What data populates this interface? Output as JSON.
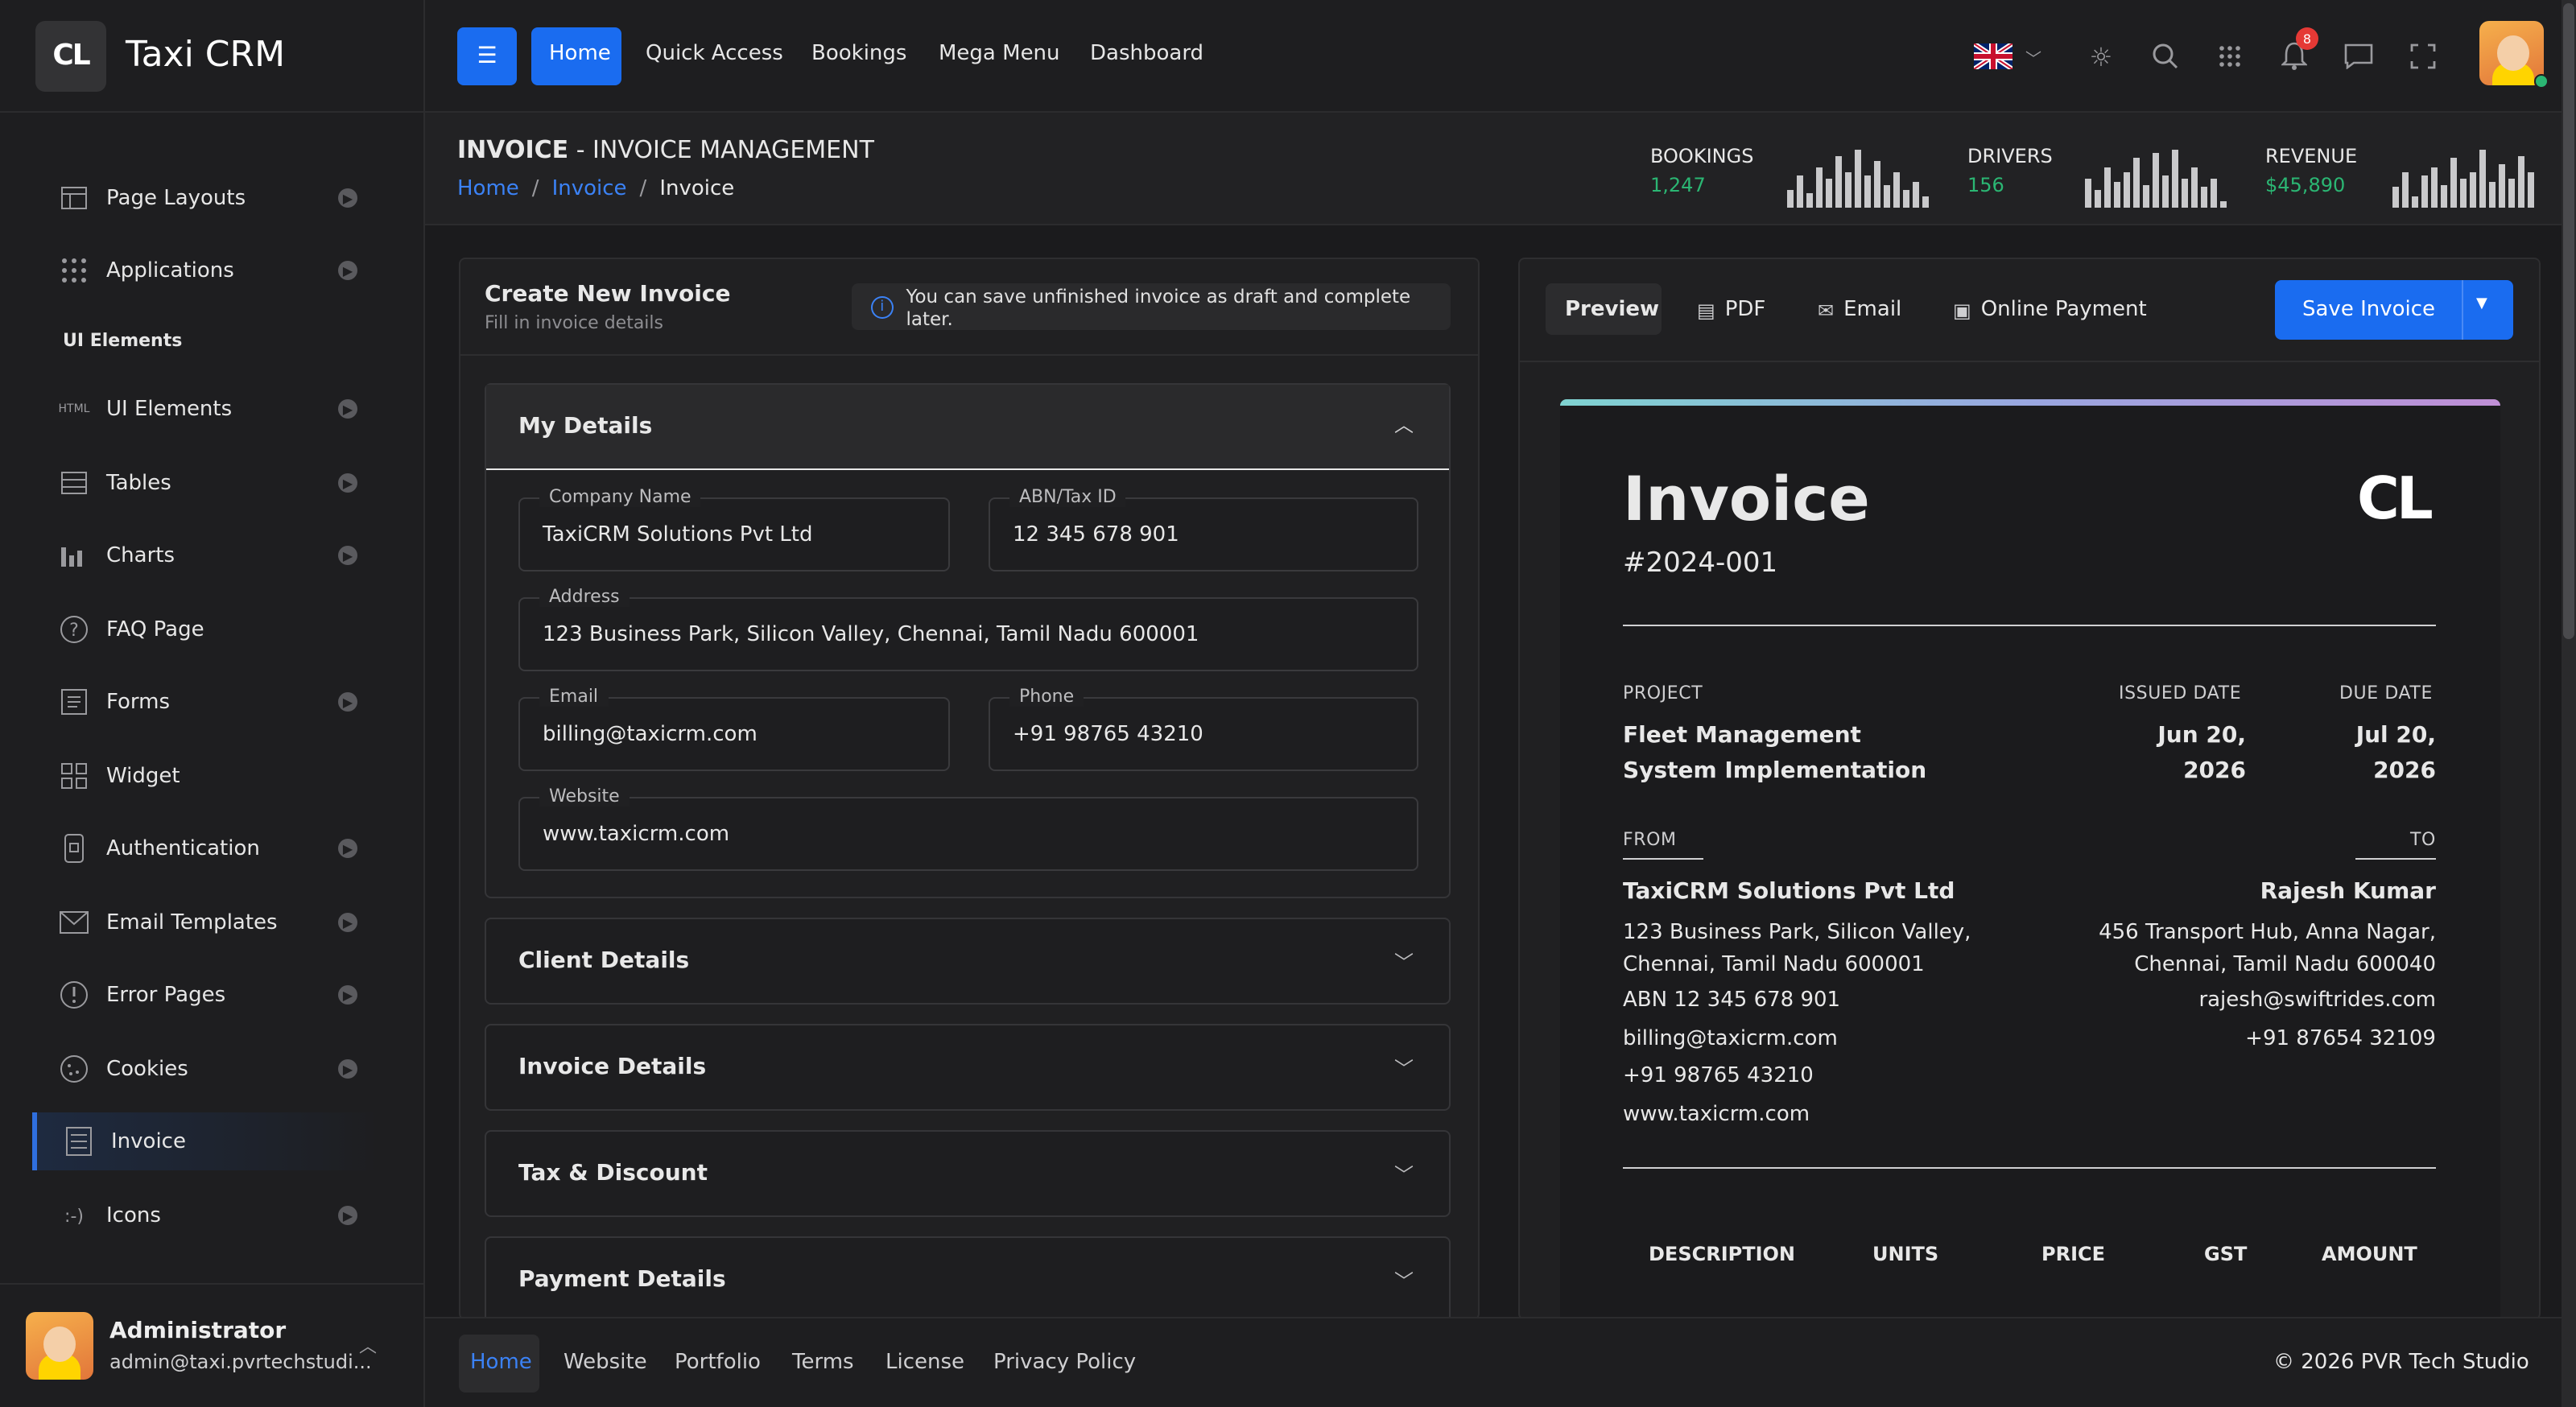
{
  "brand": {
    "logo_text": "CL",
    "name": "Taxi CRM"
  },
  "sidebar": {
    "items": [
      {
        "label": "Page Layouts",
        "icon": "layout-icon"
      },
      {
        "label": "Applications",
        "icon": "apps-grid-icon"
      },
      {
        "label": "UI Elements",
        "icon": "html-icon",
        "icon_text": "HTML"
      },
      {
        "label": "Tables",
        "icon": "table-icon"
      },
      {
        "label": "Charts",
        "icon": "bar-chart-icon"
      },
      {
        "label": "FAQ Page",
        "icon": "question-icon"
      },
      {
        "label": "Forms",
        "icon": "form-icon"
      },
      {
        "label": "Widget",
        "icon": "widget-icon"
      },
      {
        "label": "Authentication",
        "icon": "phone-lock-icon"
      },
      {
        "label": "Email Templates",
        "icon": "envelope-icon"
      },
      {
        "label": "Error Pages",
        "icon": "alert-icon"
      },
      {
        "label": "Cookies",
        "icon": "cookie-icon"
      },
      {
        "label": "Invoice",
        "icon": "invoice-icon"
      },
      {
        "label": "Icons",
        "icon": "smiley-icon",
        "icon_text": ":-)"
      }
    ],
    "section_label": "UI Elements"
  },
  "user": {
    "name": "Administrator",
    "email": "admin@taxi.pvrtechstudi..."
  },
  "topbar": {
    "menu": [
      "Home",
      "Quick Access",
      "Bookings",
      "Mega Menu",
      "Dashboard"
    ],
    "notification_count": "8"
  },
  "page": {
    "title_bold": "INVOICE",
    "title_rest": " - INVOICE MANAGEMENT",
    "breadcrumb": [
      "Home",
      "/",
      "Invoice",
      "/",
      "Invoice"
    ]
  },
  "stats": [
    {
      "label": "BOOKINGS",
      "value": "1,247",
      "bars": [
        0.3,
        0.55,
        0.25,
        0.7,
        0.5,
        0.9,
        0.6,
        1.0,
        0.55,
        0.8,
        0.4,
        0.6,
        0.3,
        0.45,
        0.2
      ]
    },
    {
      "label": "DRIVERS",
      "value": "156",
      "bars": [
        0.5,
        0.3,
        0.7,
        0.45,
        0.6,
        0.85,
        0.4,
        0.95,
        0.55,
        1.0,
        0.5,
        0.7,
        0.35,
        0.5,
        0.1
      ]
    },
    {
      "label": "REVENUE",
      "value": "$45,890",
      "bars": [
        0.35,
        0.6,
        0.2,
        0.55,
        0.7,
        0.4,
        0.85,
        0.5,
        0.6,
        1.0,
        0.45,
        0.75,
        0.5,
        0.9,
        0.6
      ]
    }
  ],
  "form": {
    "title": "Create New Invoice",
    "subtitle": "Fill in invoice details",
    "draft_note": "You can save unfinished invoice as draft and complete later.",
    "my_details": "My Details",
    "fields": {
      "company": {
        "label": "Company Name",
        "value": "TaxiCRM Solutions Pvt Ltd"
      },
      "abn": {
        "label": "ABN/Tax ID",
        "value": "12 345 678 901"
      },
      "address": {
        "label": "Address",
        "value": "123 Business Park, Silicon Valley, Chennai, Tamil Nadu 600001"
      },
      "email": {
        "label": "Email",
        "value": "billing@taxicrm.com"
      },
      "phone": {
        "label": "Phone",
        "value": "+91 98765 43210"
      },
      "website": {
        "label": "Website",
        "value": "www.taxicrm.com"
      }
    },
    "sections": [
      "Client Details",
      "Invoice Details",
      "Tax & Discount",
      "Payment Details"
    ]
  },
  "preview": {
    "tabs": [
      "Preview",
      "PDF",
      "Email",
      "Online Payment"
    ],
    "save_label": "Save Invoice"
  },
  "invoice": {
    "title": "Invoice",
    "logo_text": "CL",
    "number": "#2024-001",
    "project_label": "PROJECT",
    "project_value": "Fleet Management System Implementation",
    "issued_label": "ISSUED DATE",
    "issued_value": "Jun 20, 2026",
    "due_label": "DUE DATE",
    "due_value": "Jul 20, 2026",
    "from_label": "FROM",
    "to_label": "TO",
    "from": {
      "name": "TaxiCRM Solutions Pvt Ltd",
      "address": "123 Business Park, Silicon Valley, Chennai, Tamil Nadu 600001",
      "abn": "ABN 12 345 678 901",
      "email": "billing@taxicrm.com",
      "phone": "+91 98765 43210",
      "website": "www.taxicrm.com"
    },
    "to": {
      "name": "Rajesh Kumar",
      "address": "456 Transport Hub, Anna Nagar, Chennai, Tamil Nadu 600040",
      "email": "rajesh@swiftrides.com",
      "phone": "+91 87654 32109"
    },
    "columns": [
      "DESCRIPTION",
      "UNITS",
      "PRICE",
      "GST",
      "AMOUNT"
    ]
  },
  "footer": {
    "links": [
      "Home",
      "Website",
      "Portfolio",
      "Terms",
      "License",
      "Privacy Policy"
    ],
    "copyright": "© 2026  PVR Tech Studio"
  }
}
